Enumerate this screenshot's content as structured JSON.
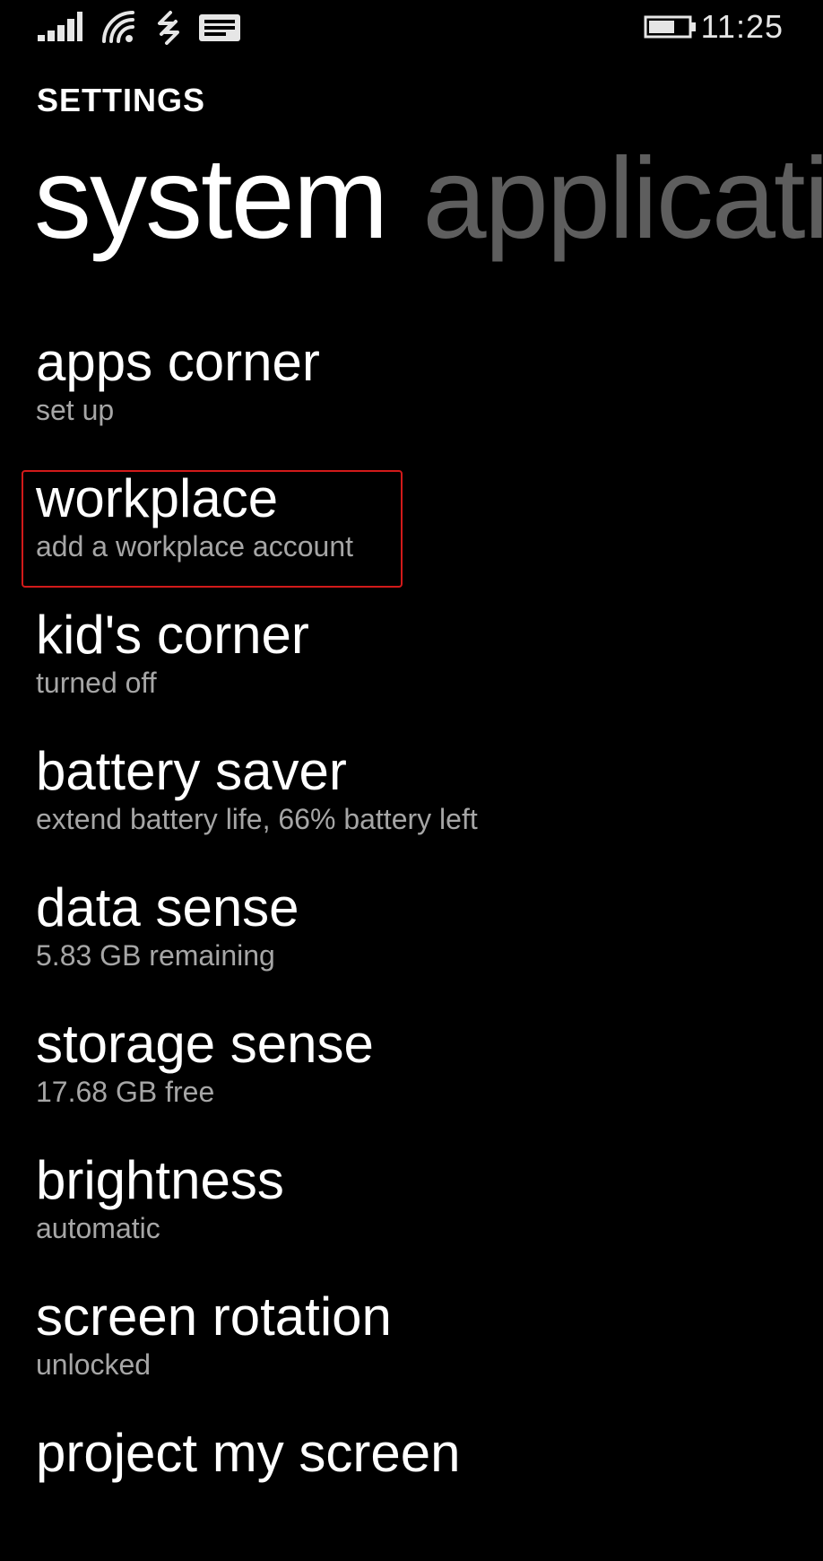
{
  "status_bar": {
    "icons": [
      "signal-strength-icon",
      "wifi-icon",
      "data-connection-icon",
      "message-icon",
      "battery-icon"
    ],
    "time": "11:25",
    "battery_level": 0.66
  },
  "app": {
    "title": "SETTINGS"
  },
  "pivot": {
    "tabs": [
      {
        "label": "system",
        "active": true
      },
      {
        "label": "applicati",
        "active": false
      }
    ]
  },
  "settings": {
    "items": [
      {
        "title": "apps corner",
        "subtitle": "set up"
      },
      {
        "title": "workplace",
        "subtitle": "add a workplace account",
        "highlighted": true
      },
      {
        "title": "kid's corner",
        "subtitle": "turned off"
      },
      {
        "title": "battery saver",
        "subtitle": "extend battery life, 66% battery left"
      },
      {
        "title": "data sense",
        "subtitle": "5.83 GB remaining"
      },
      {
        "title": "storage sense",
        "subtitle": "17.68 GB free"
      },
      {
        "title": "brightness",
        "subtitle": "automatic"
      },
      {
        "title": "screen rotation",
        "subtitle": "unlocked"
      },
      {
        "title": "project my screen",
        "subtitle": ""
      }
    ]
  },
  "colors": {
    "background": "#000000",
    "text_primary": "#ffffff",
    "text_secondary": "#a6a6a6",
    "pivot_inactive": "#5e5e5e",
    "highlight_border": "#d21a1a"
  }
}
